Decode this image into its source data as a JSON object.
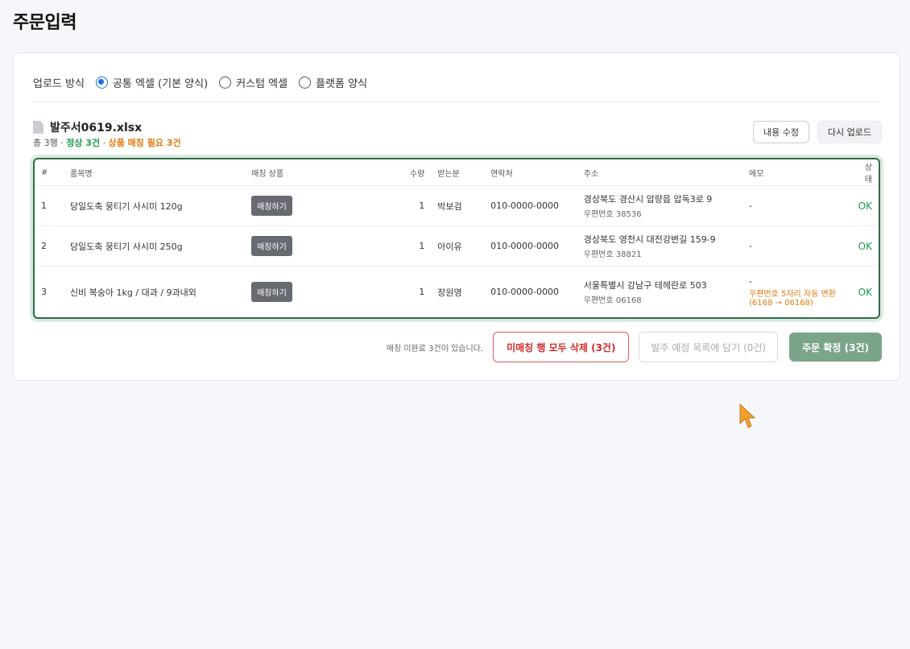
{
  "page": {
    "title": "주문입력"
  },
  "upload": {
    "label": "업로드 방식",
    "options": [
      {
        "label": "공통 엑셀 (기본 양식)",
        "checked": true
      },
      {
        "label": "커스텀 엑셀",
        "checked": false
      },
      {
        "label": "플랫폼 양식",
        "checked": false
      }
    ]
  },
  "file": {
    "name": "발주서0619.xlsx",
    "summary_total": "총 3행 · ",
    "summary_ok": "정상 3건",
    "summary_sep": " · ",
    "summary_warn": "상품 매칭 필요 3건",
    "edit_label": "내용 수정",
    "reupload_label": "다시 업로드"
  },
  "table": {
    "headers": [
      "#",
      "품목명",
      "매칭 상품",
      "수량",
      "받는분",
      "연락처",
      "주소",
      "메모",
      "상태"
    ],
    "rows": [
      {
        "no": "1",
        "product": "당일도축 뭉티기 사시미 120g",
        "match_label": "매칭하기",
        "qty": "1",
        "recipient": "박보검",
        "phone": "010-0000-0000",
        "address": "경상북도 경산시 압량읍 압독3로 9",
        "zip": "우편번호 38536",
        "memo": "-",
        "memo_note": "",
        "status": "OK"
      },
      {
        "no": "2",
        "product": "당일도축 뭉티기 사시미 250g",
        "match_label": "매칭하기",
        "qty": "1",
        "recipient": "아이유",
        "phone": "010-0000-0000",
        "address": "경상북도 영천시 대전강변길 159-9",
        "zip": "우편번호 38821",
        "memo": "-",
        "memo_note": "",
        "status": "OK"
      },
      {
        "no": "3",
        "product": "신비 복숭아 1kg / 대과 / 9과내외",
        "match_label": "매칭하기",
        "qty": "1",
        "recipient": "장원영",
        "phone": "010-0000-0000",
        "address": "서울특별시 강남구 테헤란로 503",
        "zip": "우편번호 06168",
        "memo": "-",
        "memo_note": "우편번호 5자리 자동 변환 (6168 → 06168)",
        "status": "OK"
      }
    ]
  },
  "footer": {
    "note": "매칭 미완료 3건이 있습니다.",
    "delete_label": "미매칭 행 모두 삭제 (3건)",
    "basket_label": "발주 예정 목록에 담기 (0건)",
    "confirm_label": "주문 확정 (3건)"
  },
  "colors": {
    "accent": "#1f6fe0",
    "ok": "#1a9a4a",
    "warn": "#e07a10",
    "danger": "#d02b2b",
    "confirm": "#7aa58a",
    "table_border": "#2f6a47"
  }
}
